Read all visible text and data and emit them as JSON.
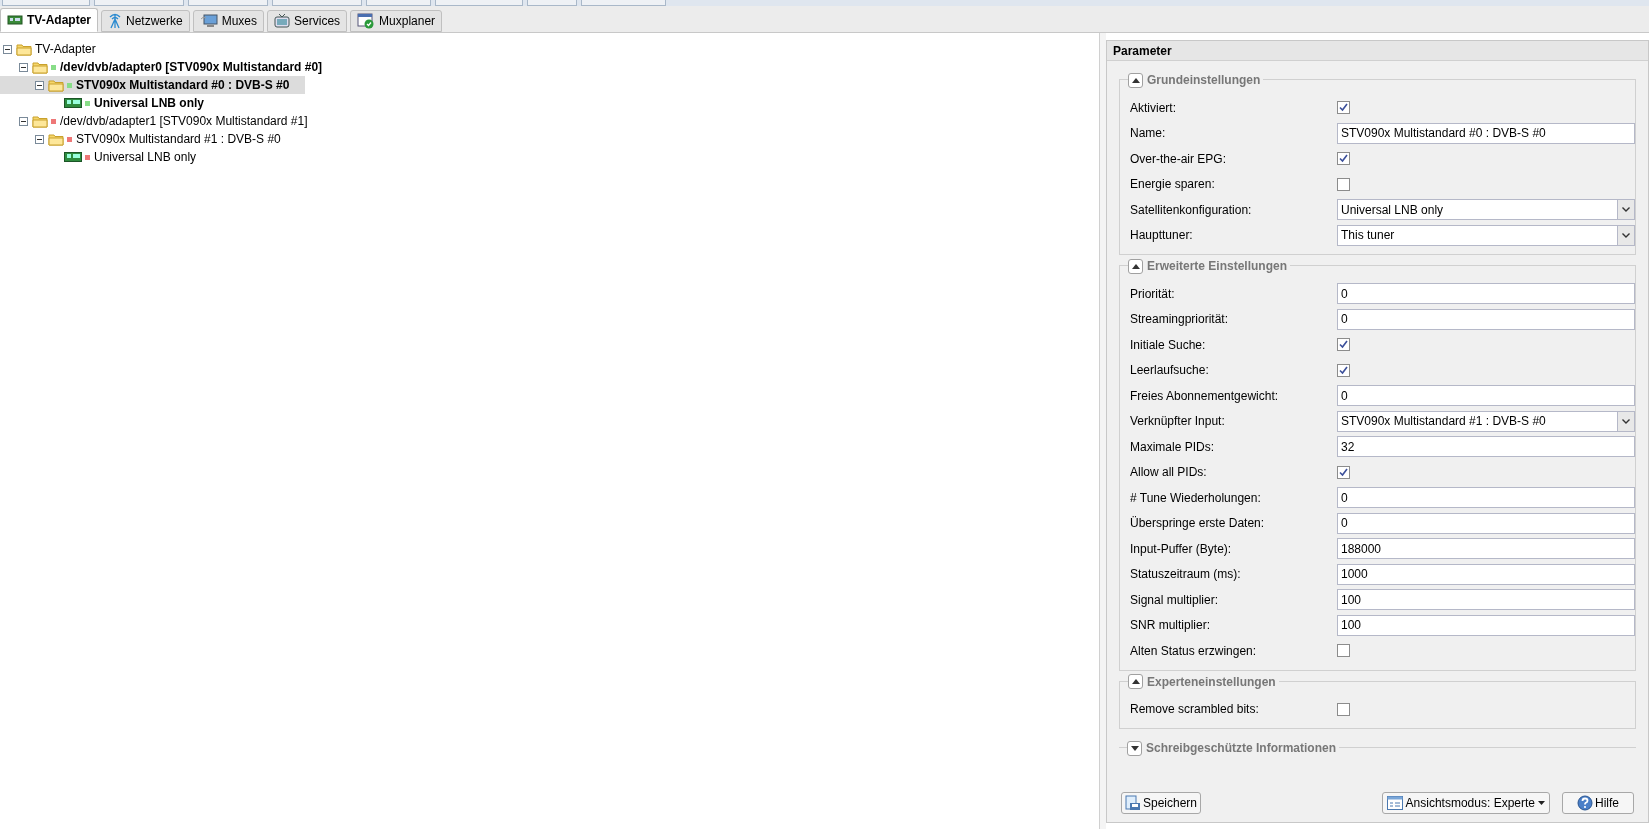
{
  "tabs": [
    {
      "label": "TV-Adapter",
      "selected": true
    },
    {
      "label": "Netzwerke",
      "selected": false
    },
    {
      "label": "Muxes",
      "selected": false
    },
    {
      "label": "Services",
      "selected": false
    },
    {
      "label": "Muxplaner",
      "selected": false
    }
  ],
  "tree": [
    {
      "label": "TV-Adapter",
      "kind": "folder",
      "expanded": true,
      "children": [
        {
          "label": "/dev/dvb/adapter0 [STV090x Multistandard #0]",
          "kind": "folder",
          "expanded": true,
          "active": true,
          "color": "#88dd88",
          "selected": false,
          "children": [
            {
              "label": "STV090x Multistandard #0 : DVB-S #0",
              "kind": "folder",
              "expanded": true,
              "active": true,
              "color": "#88dd88",
              "selected": true,
              "children": [
                {
                  "label": "Universal LNB only",
                  "kind": "device",
                  "active": true,
                  "color": "#88dd88",
                  "selected": false
                }
              ]
            }
          ]
        },
        {
          "label": "/dev/dvb/adapter1 [STV090x Multistandard #1]",
          "kind": "folder",
          "expanded": true,
          "active": false,
          "color": "#ee7777",
          "selected": false,
          "children": [
            {
              "label": "STV090x Multistandard #1 : DVB-S #0",
              "kind": "folder",
              "expanded": true,
              "active": false,
              "color": "#ee7777",
              "selected": false,
              "children": [
                {
                  "label": "Universal LNB only",
                  "kind": "device",
                  "active": false,
                  "color": "#ee7777",
                  "selected": false
                }
              ]
            }
          ]
        }
      ]
    }
  ],
  "parameter": {
    "title": "Parameter",
    "sections": [
      {
        "title": "Grundeinstellungen",
        "expanded": true,
        "rows": [
          {
            "label": "Aktiviert:",
            "kind": "checkbox",
            "checked": true
          },
          {
            "label": "Name:",
            "kind": "text",
            "value": "STV090x Multistandard #0 : DVB-S #0"
          },
          {
            "label": "Over-the-air EPG:",
            "kind": "checkbox",
            "checked": true
          },
          {
            "label": "Energie sparen:",
            "kind": "checkbox",
            "checked": false
          },
          {
            "label": "Satellitenkonfiguration:",
            "kind": "select",
            "value": "Universal LNB only"
          },
          {
            "label": "Haupttuner:",
            "kind": "select",
            "value": "This tuner"
          }
        ]
      },
      {
        "title": "Erweiterte Einstellungen",
        "expanded": true,
        "rows": [
          {
            "label": "Priorität:",
            "kind": "text",
            "value": "0"
          },
          {
            "label": "Streamingpriorität:",
            "kind": "text",
            "value": "0"
          },
          {
            "label": "Initiale Suche:",
            "kind": "checkbox",
            "checked": true
          },
          {
            "label": "Leerlaufsuche:",
            "kind": "checkbox",
            "checked": true
          },
          {
            "label": "Freies Abonnementgewicht:",
            "kind": "text",
            "value": "0"
          },
          {
            "label": "Verknüpfter Input:",
            "kind": "select",
            "value": "STV090x Multistandard #1 : DVB-S #0"
          },
          {
            "label": "Maximale PIDs:",
            "kind": "text",
            "value": "32"
          },
          {
            "label": "Allow all PIDs:",
            "kind": "checkbox",
            "checked": true
          },
          {
            "label": "# Tune Wiederholungen:",
            "kind": "text",
            "value": "0"
          },
          {
            "label": "Überspringe erste Daten:",
            "kind": "text",
            "value": "0"
          },
          {
            "label": "Input-Puffer (Byte):",
            "kind": "text",
            "value": "188000"
          },
          {
            "label": "Statuszeitraum (ms):",
            "kind": "text",
            "value": "1000"
          },
          {
            "label": "Signal multiplier:",
            "kind": "text",
            "value": "100"
          },
          {
            "label": "SNR multiplier:",
            "kind": "text",
            "value": "100"
          },
          {
            "label": "Alten Status erzwingen:",
            "kind": "checkbox",
            "checked": false
          }
        ]
      },
      {
        "title": "Experteneinstellungen",
        "expanded": true,
        "rows": [
          {
            "label": "Remove scrambled bits:",
            "kind": "checkbox",
            "checked": false
          }
        ]
      },
      {
        "title": "Schreibgeschützte Informationen",
        "expanded": false
      }
    ],
    "buttons": {
      "save": "Speichern",
      "view_mode": "Ansichtsmodus: Experte",
      "help": "Hilfe"
    }
  }
}
